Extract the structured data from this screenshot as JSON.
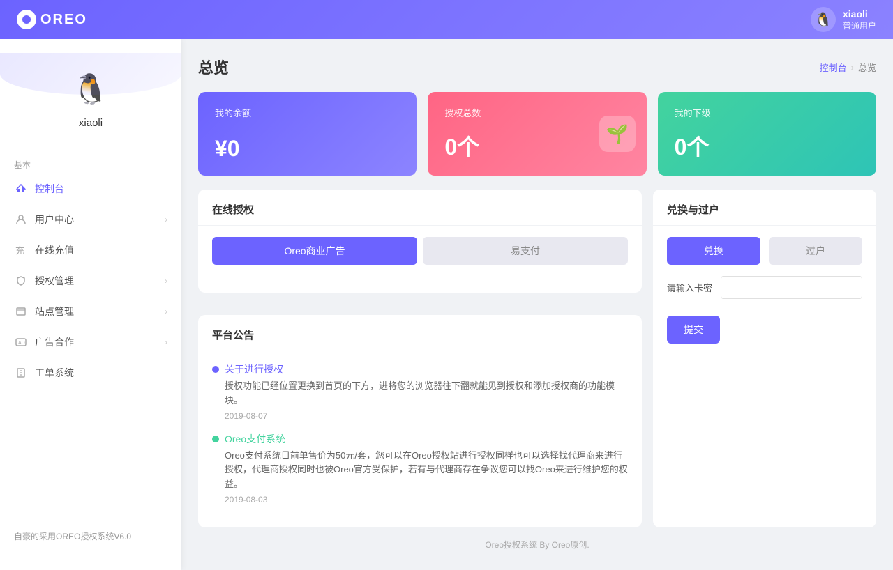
{
  "header": {
    "logo_text": "OREO",
    "user_name": "xiaoli",
    "user_role": "普通用户"
  },
  "sidebar": {
    "username": "xiaoli",
    "section_basic": "基本",
    "items": [
      {
        "id": "dashboard",
        "label": "控制台",
        "icon": "📊",
        "active": true,
        "arrow": false
      },
      {
        "id": "user-center",
        "label": "用户中心",
        "icon": "👤",
        "active": false,
        "arrow": true
      },
      {
        "id": "recharge",
        "label": "在线充值",
        "icon": "💳",
        "active": false,
        "arrow": false
      },
      {
        "id": "auth-manage",
        "label": "授权管理",
        "icon": "🛡️",
        "active": false,
        "arrow": true
      },
      {
        "id": "site-manage",
        "label": "站点管理",
        "icon": "🖥️",
        "active": false,
        "arrow": true
      },
      {
        "id": "ad-coop",
        "label": "广告合作",
        "icon": "📺",
        "active": false,
        "arrow": true
      },
      {
        "id": "work-order",
        "label": "工单系统",
        "icon": "📋",
        "active": false,
        "arrow": false
      }
    ],
    "footer_text": "自豪的采用OREO授权系统V6.0"
  },
  "breadcrumb": {
    "page_title": "总览",
    "nav_link": "控制台",
    "nav_sep": "›",
    "nav_current": "总览"
  },
  "stats": [
    {
      "id": "balance",
      "label": "我的余额",
      "value": "¥0",
      "color": "blue",
      "icon": null
    },
    {
      "id": "auth-count",
      "label": "授权总数",
      "value": "0个",
      "color": "pink",
      "icon": "🌱"
    },
    {
      "id": "subordinate",
      "label": "我的下级",
      "value": "0个",
      "color": "green",
      "icon": null
    }
  ],
  "announcements": {
    "title": "平台公告",
    "items": [
      {
        "id": "ann1",
        "dot_color": "blue",
        "title": "关于进行授权",
        "title_color": "blue",
        "content": "授权功能已经位置更换到首页的下方，进将您的浏览器往下翻就能见到授权和添加授权商的功能模块。",
        "date": "2019-08-07"
      },
      {
        "id": "ann2",
        "dot_color": "green",
        "title": "Oreo支付系统",
        "title_color": "green",
        "content": "Oreo支付系统目前单售价为50元/套，您可以在Oreo授权站进行授权同样也可以选择找代理商来进行授权，代理商授权同时也被Oreo官方受保护，若有与代理商存在争议您可以找Oreo来进行维护您的权益。",
        "date": "2019-08-03"
      }
    ]
  },
  "online_auth": {
    "section_title": "在线授权",
    "tabs": [
      {
        "id": "oreo-ad",
        "label": "Oreo商业广告",
        "active": true
      },
      {
        "id": "easy-pay",
        "label": "易支付",
        "active": false
      }
    ]
  },
  "exchange": {
    "section_title": "兑换与过户",
    "tabs": [
      {
        "id": "redeem",
        "label": "兑换",
        "active": true
      },
      {
        "id": "transfer",
        "label": "过户",
        "active": false
      }
    ],
    "field_label": "请输入卡密",
    "field_placeholder": "",
    "submit_label": "提交"
  },
  "footer": {
    "text": "Oreo授权系统 By Oreo原创."
  }
}
